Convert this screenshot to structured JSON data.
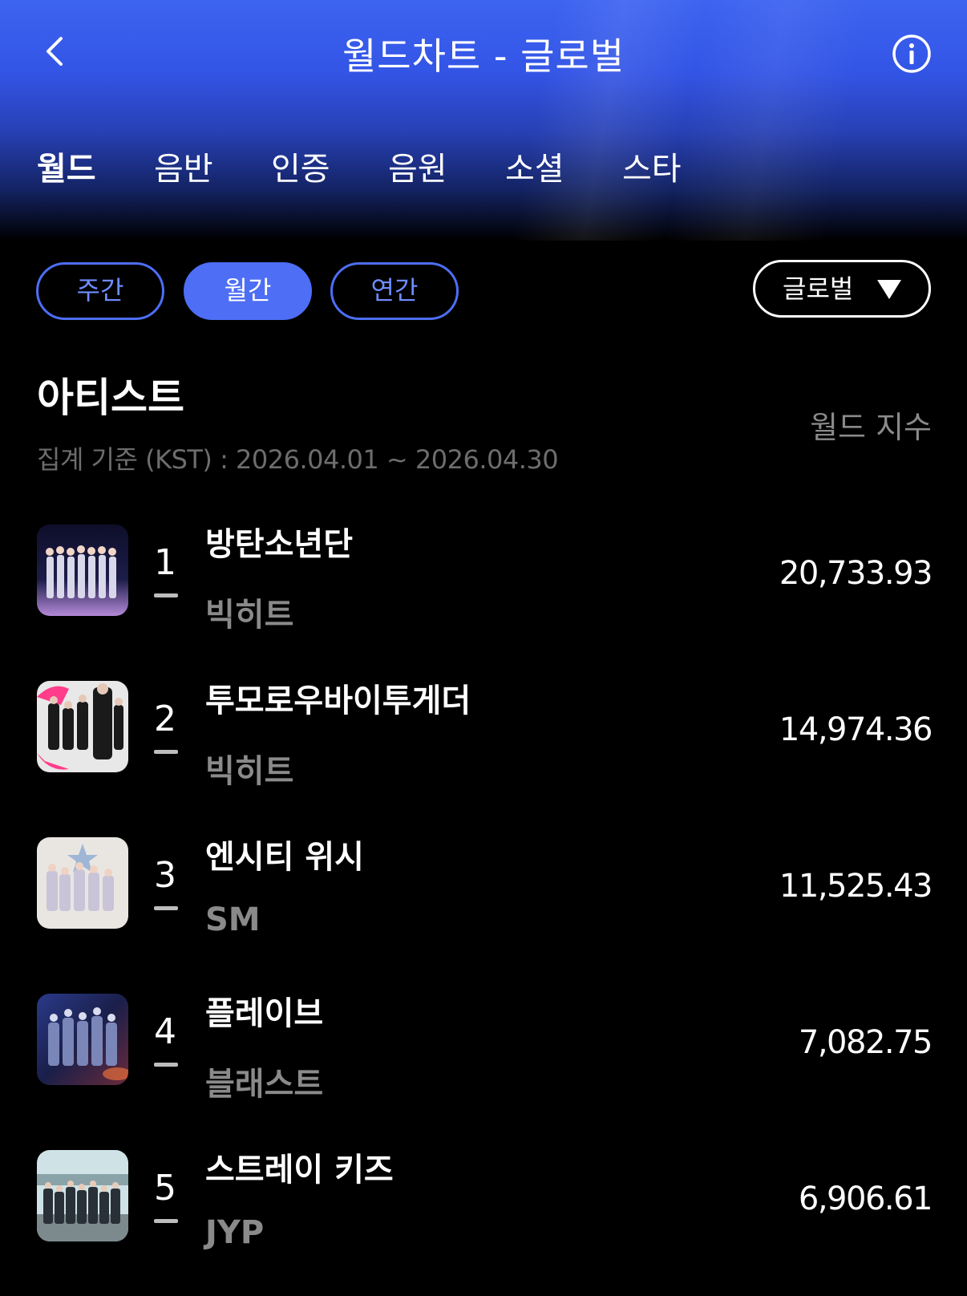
{
  "header": {
    "title": "월드차트 - 글로벌",
    "back_icon": "chevron-left-icon",
    "info_icon": "info-icon"
  },
  "tabs": [
    {
      "label": "월드",
      "active": true
    },
    {
      "label": "음반",
      "active": false
    },
    {
      "label": "인증",
      "active": false
    },
    {
      "label": "음원",
      "active": false
    },
    {
      "label": "소셜",
      "active": false
    },
    {
      "label": "스타",
      "active": false
    }
  ],
  "period_filters": [
    {
      "label": "주간",
      "active": false
    },
    {
      "label": "월간",
      "active": true
    },
    {
      "label": "연간",
      "active": false
    }
  ],
  "region_select": {
    "value": "글로벌",
    "icon": "triangle-down-icon"
  },
  "section": {
    "title": "아티스트",
    "period": "집계 기준 (KST) : 2026.04.01 ~ 2026.04.30",
    "column_header": "월드 지수"
  },
  "rankings": [
    {
      "rank": "1",
      "artist": "방탄소년단",
      "agency": "빅히트",
      "score": "20,733.93",
      "trend": "none"
    },
    {
      "rank": "2",
      "artist": "투모로우바이투게더",
      "agency": "빅히트",
      "score": "14,974.36",
      "trend": "none"
    },
    {
      "rank": "3",
      "artist": "엔시티 위시",
      "agency": "SM",
      "score": "11,525.43",
      "trend": "none"
    },
    {
      "rank": "4",
      "artist": "플레이브",
      "agency": "블래스트",
      "score": "7,082.75",
      "trend": "none"
    },
    {
      "rank": "5",
      "artist": "스트레이 키즈",
      "agency": "JYP",
      "score": "6,906.61",
      "trend": "none"
    }
  ],
  "colors": {
    "accent": "#4d6ef5",
    "header_top": "#3d63f0",
    "muted_text": "#8a8a8a",
    "background": "#000000"
  }
}
